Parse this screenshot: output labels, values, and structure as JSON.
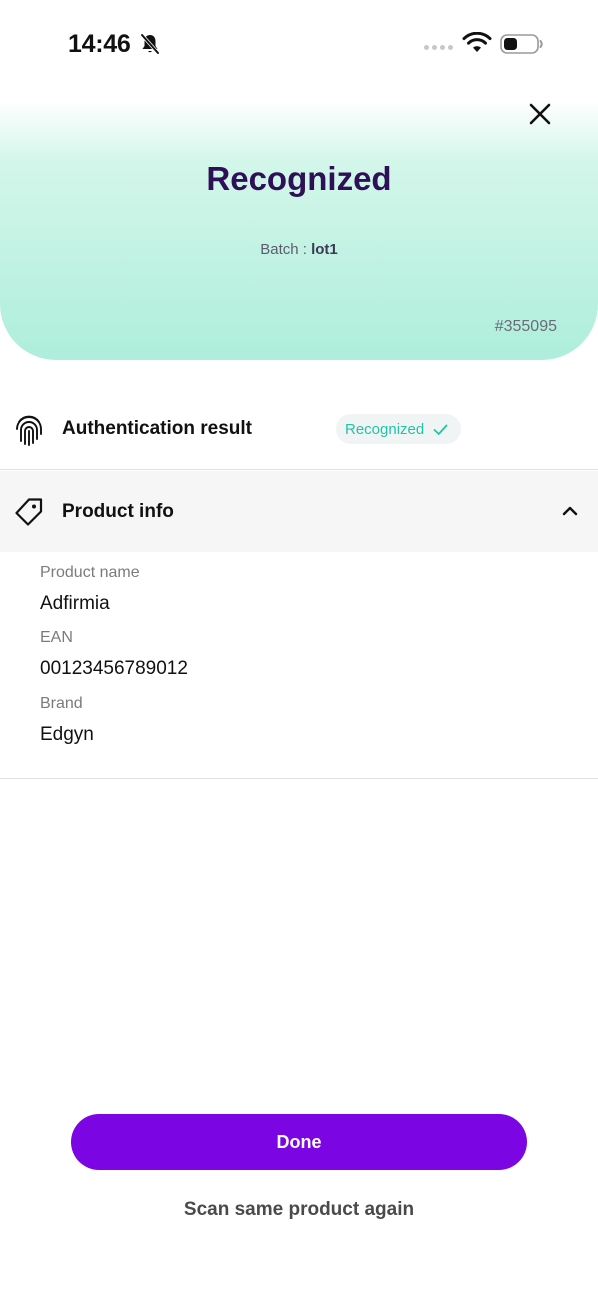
{
  "status_bar": {
    "time": "14:46",
    "icons": [
      "bell-muted-icon",
      "signal-icon",
      "wifi-icon",
      "battery-icon"
    ]
  },
  "header": {
    "title": "Recognized",
    "batch_prefix": "Batch : ",
    "batch_value": "lot1",
    "reference": "#355095",
    "close_icon": "close-icon"
  },
  "authentication": {
    "label": "Authentication result",
    "status": "Recognized",
    "status_color": "#23c3a7",
    "icon": "fingerprint-icon"
  },
  "product_info": {
    "title": "Product info",
    "icon": "tag-icon",
    "expanded": true,
    "fields": [
      {
        "label": "Product name",
        "value": "Adfirmia"
      },
      {
        "label": "EAN",
        "value": "00123456789012"
      },
      {
        "label": "Brand",
        "value": "Edgyn"
      }
    ]
  },
  "actions": {
    "done_label": "Done",
    "scan_again_label": "Scan same product again"
  },
  "colors": {
    "primary": "#7b05e3",
    "title": "#2d1055",
    "header_gradient_end": "#aeeedb"
  }
}
